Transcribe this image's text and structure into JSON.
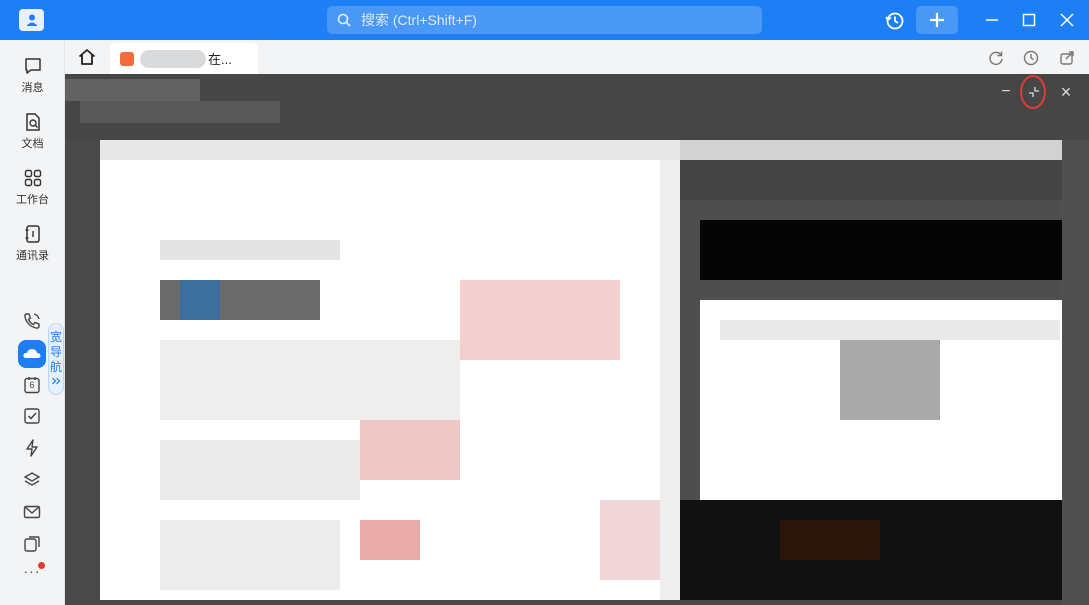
{
  "app": {
    "search_placeholder": "搜索 (Ctrl+Shift+F)",
    "accent": "#1e7ff5"
  },
  "sidebar": {
    "items": [
      {
        "label": "消息",
        "icon": "chat-bubble-icon"
      },
      {
        "label": "文档",
        "icon": "document-search-icon"
      },
      {
        "label": "工作台",
        "icon": "grid-apps-icon"
      },
      {
        "label": "通讯录",
        "icon": "contacts-book-icon"
      }
    ],
    "nav_guide": "宽导航",
    "small_icons": [
      "phone-icon",
      "cloud-disk-icon",
      "calendar-icon",
      "task-check-icon",
      "lightning-icon",
      "layers-icon",
      "mail-icon",
      "docs-icon",
      "more-icon"
    ],
    "calendar_day": "6",
    "more": "···"
  },
  "tabs": [
    {
      "label": "在..."
    }
  ],
  "viewer": {
    "minimize": "−",
    "close": "×"
  }
}
